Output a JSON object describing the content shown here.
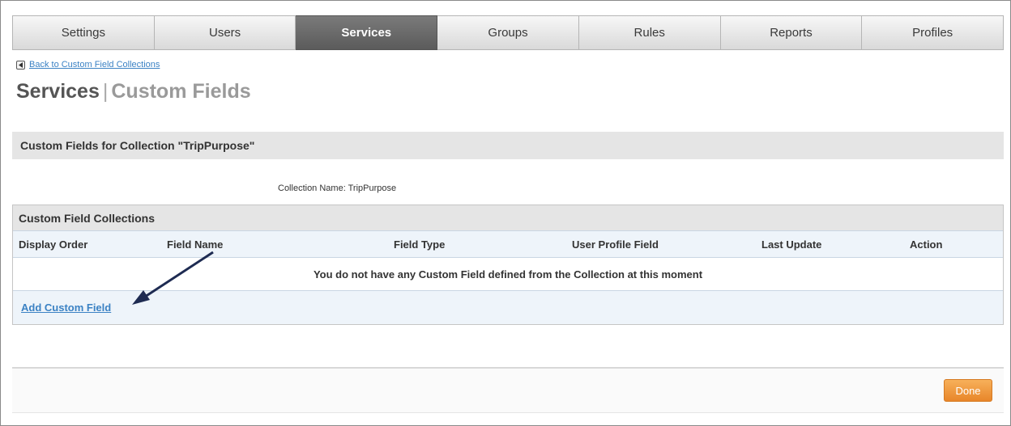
{
  "tabs": [
    {
      "label": "Settings",
      "active": false
    },
    {
      "label": "Users",
      "active": false
    },
    {
      "label": "Services",
      "active": true
    },
    {
      "label": "Groups",
      "active": false
    },
    {
      "label": "Rules",
      "active": false
    },
    {
      "label": "Reports",
      "active": false
    },
    {
      "label": "Profiles",
      "active": false
    }
  ],
  "back_link": {
    "label": "Back to Custom Field Collections",
    "icon": "back-arrow-icon"
  },
  "page_title": {
    "main": "Services",
    "separator": "|",
    "sub": "Custom Fields"
  },
  "section_header": "Custom Fields for Collection \"TripPurpose\"",
  "collection_name": "Collection Name: TripPurpose",
  "collections_table": {
    "title": "Custom Field Collections",
    "columns": [
      "Display Order",
      "Field Name",
      "Field Type",
      "User Profile Field",
      "Last Update",
      "Action"
    ],
    "empty_message": "You do not have any Custom Field defined from the Collection at this moment",
    "add_link": "Add Custom Field"
  },
  "footer": {
    "done_label": "Done"
  },
  "colors": {
    "active_tab": "#5b5b5b",
    "link": "#3b82c4",
    "done_button": "#e8862a",
    "arrow": "#1e2b52"
  }
}
